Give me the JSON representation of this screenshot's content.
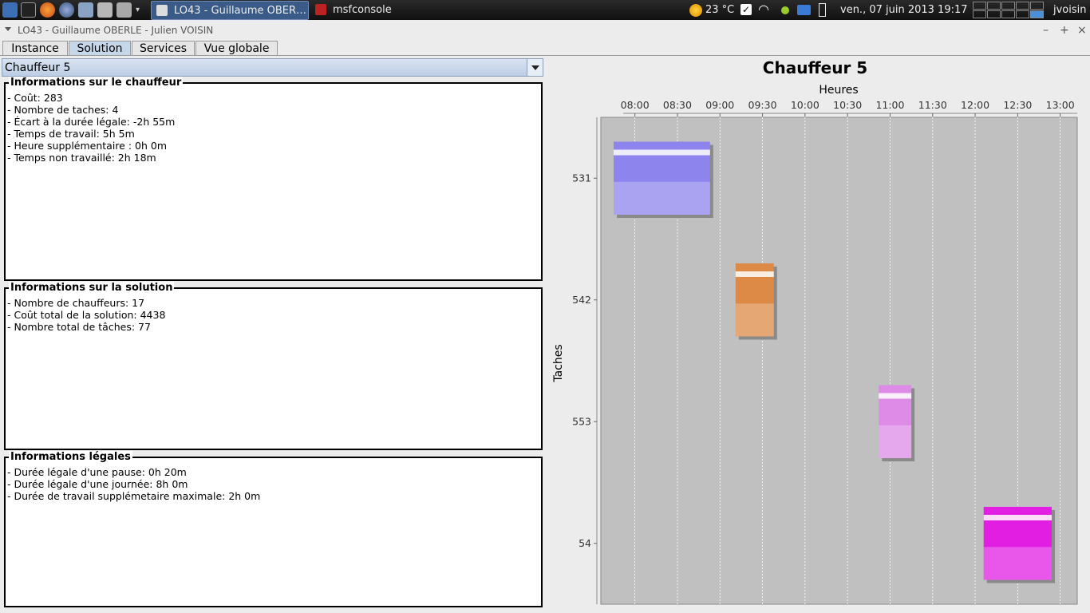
{
  "taskbar": {
    "tasks": [
      {
        "label": "LO43 - Guillaume OBER…",
        "active": true
      },
      {
        "label": "msfconsole",
        "active": false
      }
    ],
    "weather": "23 °C",
    "clock": "ven., 07 juin 2013 19:17",
    "user": "jvoisin"
  },
  "window": {
    "title": "LO43 - Guillaume OBERLE - Julien VOISIN",
    "controls": [
      "–",
      "+",
      "×"
    ]
  },
  "tabs": [
    "Instance",
    "Solution",
    "Services",
    "Vue globale"
  ],
  "selected_tab": "Solution",
  "driver_select": {
    "value": "Chauffeur 5"
  },
  "panels": {
    "driver": {
      "title": "Informations sur le chauffeur",
      "lines": [
        "- Coût: 283",
        "- Nombre de taches: 4",
        "- Écart à la durée légale: -2h 55m",
        "- Temps de travail: 5h 5m",
        "- Heure supplémentaire : 0h 0m",
        "- Temps non travaillé: 2h 18m"
      ]
    },
    "solution": {
      "title": "Informations sur la solution",
      "lines": [
        "- Nombre de chauffeurs: 17",
        "- Coût total de la solution: 4438",
        "- Nombre total de tâches: 77"
      ]
    },
    "legal": {
      "title": "Informations légales",
      "lines": [
        "- Durée légale d'une pause: 0h 20m",
        "- Durée légale d'une journée: 8h 0m",
        "- Durée de travail supplémetaire maximale: 2h 0m"
      ]
    }
  },
  "chart_data": {
    "type": "gantt",
    "title": "Chauffeur 5",
    "xlabel": "Heures",
    "ylabel": "Taches",
    "x_ticks": [
      "08:00",
      "08:30",
      "09:00",
      "09:30",
      "10:00",
      "10:30",
      "11:00",
      "11:30",
      "12:00",
      "12:30",
      "13:00"
    ],
    "xlim": [
      "07:36",
      "13:12"
    ],
    "grid": true,
    "tasks": [
      {
        "label": "531",
        "start": "07:45",
        "end": "08:53",
        "color": "#8d84ee"
      },
      {
        "label": "542",
        "start": "09:11",
        "end": "09:38",
        "color": "#dc8a45"
      },
      {
        "label": "553",
        "start": "10:52",
        "end": "11:15",
        "color": "#dd8be6"
      },
      {
        "label": "54",
        "start": "12:06",
        "end": "12:54",
        "color": "#e21ee3"
      }
    ]
  }
}
